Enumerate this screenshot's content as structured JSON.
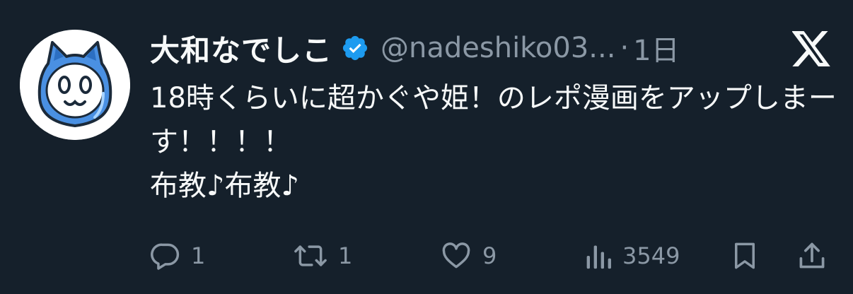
{
  "tweet": {
    "display_name": "大和なでしこ",
    "handle": "@nadeshiko03...",
    "separator": "·",
    "time": "1日",
    "text": "18時くらいに超かぐや姫！のレポ漫画をアップしまーす！！！！\n布教♪布教♪",
    "verified": true
  },
  "actions": {
    "replies": "1",
    "reposts": "1",
    "likes": "9",
    "views": "3549"
  },
  "icons": {
    "verified": "verified-badge-icon",
    "platform": "x-logo-icon",
    "reply": "reply-icon",
    "repost": "repost-icon",
    "like": "heart-icon",
    "views": "views-bar-chart-icon",
    "bookmark": "bookmark-icon",
    "share": "share-icon"
  },
  "colors": {
    "background": "#15202b",
    "text": "#f7f9f9",
    "secondary": "#8b98a5",
    "verified": "#1d9bf0",
    "avatar_blue": "#4a90e2"
  }
}
